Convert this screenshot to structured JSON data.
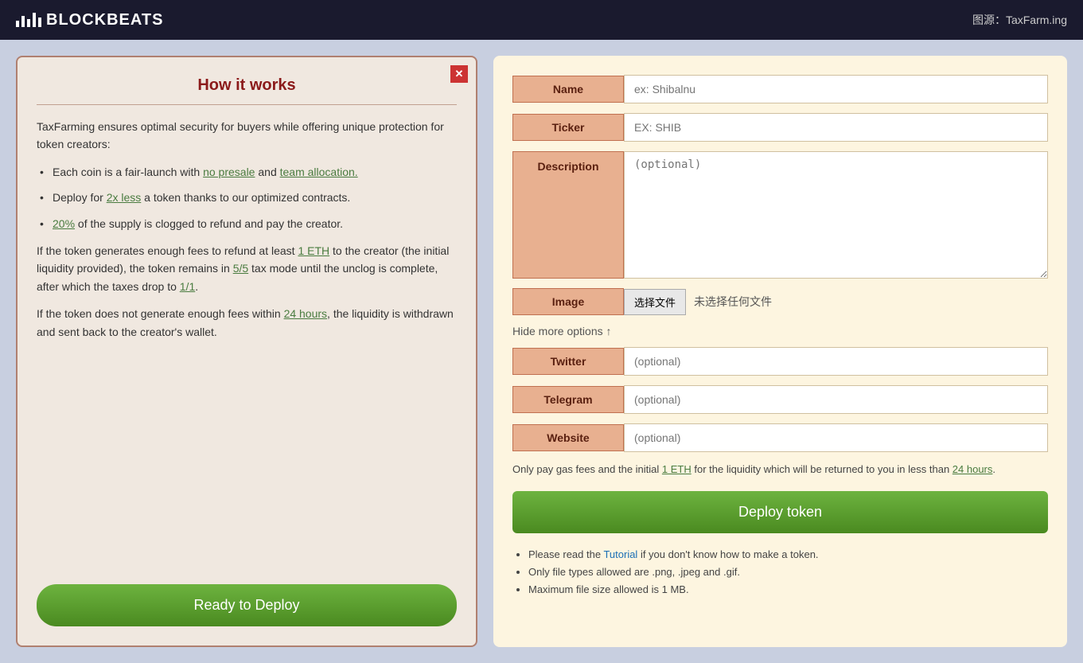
{
  "topbar": {
    "logo_text": "BLOCKBEATS",
    "attribution": "图源：TaxFarm.ing"
  },
  "left_panel": {
    "title": "How it works",
    "intro": "TaxFarming ensures optimal security for buyers while offering unique protection for token creators:",
    "bullets": [
      {
        "text_before": "Each coin is a fair-launch with ",
        "link1_text": "no presale",
        "text_middle": " and ",
        "link2_text": "team allocation.",
        "text_after": ""
      },
      {
        "text_before": "Deploy for ",
        "link1_text": "2x less",
        "text_after": " a token thanks to our optimized contracts."
      },
      {
        "text_before": "",
        "link1_text": "20%",
        "text_after": " of the supply is clogged to refund and pay the creator."
      }
    ],
    "paragraph1_before": "If the token generates enough fees to refund at least ",
    "paragraph1_link": "1 ETH",
    "paragraph1_after": " to the creator (the initial liquidity provided), the token remains in ",
    "paragraph1_link2": "5/5",
    "paragraph1_after2": " tax mode until the unclog is complete, after which the taxes drop to ",
    "paragraph1_link3": "1/1",
    "paragraph1_end": ".",
    "paragraph2_before": "If the token does not generate enough fees within ",
    "paragraph2_link": "24 hours",
    "paragraph2_after": ", the liquidity is withdrawn and sent back to the creator's wallet.",
    "ready_btn": "Ready to Deploy"
  },
  "right_panel": {
    "name_label": "Name",
    "name_placeholder": "ex: Shibalnu",
    "ticker_label": "Ticker",
    "ticker_placeholder": "EX: SHIB",
    "description_label": "Description",
    "description_placeholder": "(optional)",
    "image_label": "Image",
    "choose_file_btn": "选择文件",
    "no_file_text": "未选择任何文件",
    "hide_options": "Hide more options ↑",
    "twitter_label": "Twitter",
    "twitter_placeholder": "(optional)",
    "telegram_label": "Telegram",
    "telegram_placeholder": "(optional)",
    "website_label": "Website",
    "website_placeholder": "(optional)",
    "bottom_note_before": "Only pay gas fees and the initial ",
    "bottom_note_link": "1 ETH",
    "bottom_note_middle": " for the liquidity which will be returned to you in less than ",
    "bottom_note_link2": "24 hours",
    "bottom_note_end": ".",
    "deploy_btn": "Deploy token",
    "bullet_notes": [
      "Please read the Tutorial if you don't know how to make a token.",
      "Only file types allowed are .png, .jpeg and .gif.",
      "Maximum file size allowed is 1 MB."
    ],
    "tutorial_link_text": "Tutorial"
  }
}
